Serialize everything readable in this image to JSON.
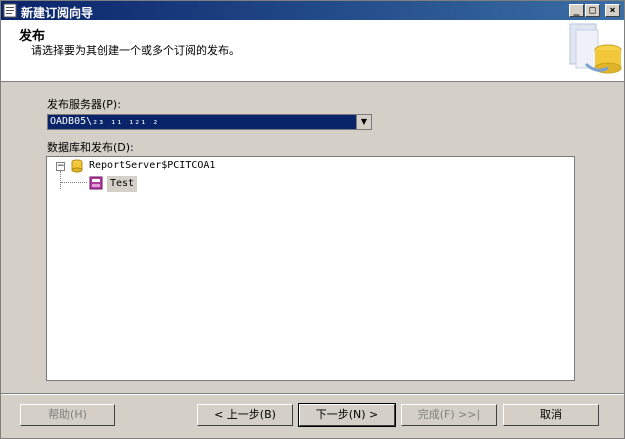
{
  "window": {
    "title": "新建订阅向导",
    "controls": {
      "minimize": "_",
      "maximize": "□",
      "close": "×"
    }
  },
  "header": {
    "title": "发布",
    "subtitle": "请选择要为其创建一个或多个订阅的发布。"
  },
  "publisher": {
    "label": "发布服务器(P):",
    "value": "OADB05\\₂₃ ₁₁ ₁₂₁ ₂",
    "dropdown_icon": "chevron-down-icon"
  },
  "tree": {
    "label": "数据库和发布(D):",
    "items": [
      {
        "label": "ReportServer$PCITCOA1",
        "icon": "database-icon",
        "expanded": true,
        "children": [
          {
            "label": "Test",
            "icon": "publication-icon",
            "selected": true
          }
        ]
      }
    ]
  },
  "buttons": {
    "help": "帮助(H)",
    "back": "< 上一步(B)",
    "next": "下一步(N) >",
    "finish": "完成(F) >>|",
    "cancel": "取消"
  },
  "colors": {
    "titlebar_start": "#0a246a",
    "titlebar_end": "#3a6ea5",
    "selection": "#0a246a",
    "face": "#d4d0c8"
  }
}
